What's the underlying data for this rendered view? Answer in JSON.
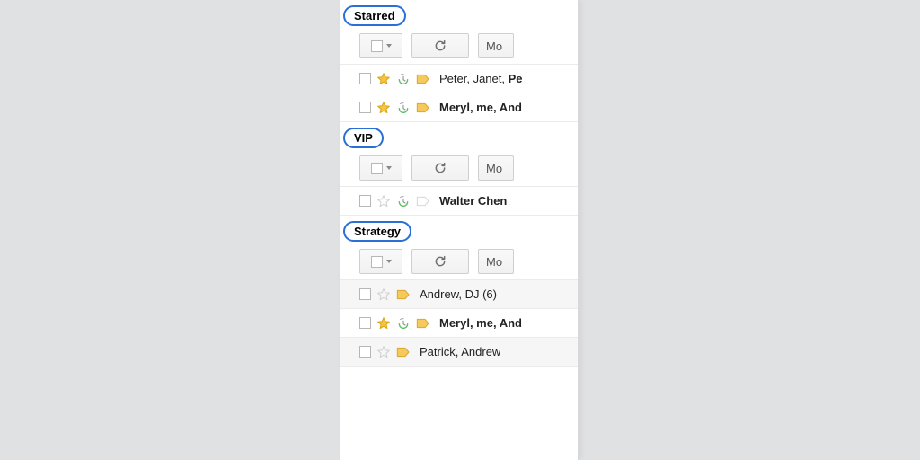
{
  "toolbar": {
    "more_label": "Mo"
  },
  "sections": [
    {
      "title": "Starred",
      "rows": [
        {
          "starred": true,
          "starOutline": false,
          "clock": true,
          "label": true,
          "labelFilled": true,
          "unread": false,
          "readbg": false,
          "sender_html": "Peter, Janet, <b>Pe</b>"
        },
        {
          "starred": true,
          "starOutline": false,
          "clock": true,
          "label": true,
          "labelFilled": true,
          "unread": true,
          "readbg": false,
          "sender_html": "Meryl, me, And"
        }
      ]
    },
    {
      "title": "VIP",
      "rows": [
        {
          "starred": false,
          "starOutline": true,
          "clock": true,
          "label": true,
          "labelFilled": false,
          "unread": true,
          "readbg": false,
          "sender_html": "Walter Chen"
        }
      ]
    },
    {
      "title": "Strategy",
      "rows": [
        {
          "starred": false,
          "starOutline": true,
          "clock": false,
          "label": true,
          "labelFilled": true,
          "unread": false,
          "readbg": true,
          "sender_html": "Andrew, DJ (6)"
        },
        {
          "starred": true,
          "starOutline": false,
          "clock": true,
          "label": true,
          "labelFilled": true,
          "unread": true,
          "readbg": false,
          "sender_html": "Meryl, me, And"
        },
        {
          "starred": false,
          "starOutline": true,
          "clock": false,
          "label": true,
          "labelFilled": true,
          "unread": false,
          "readbg": true,
          "sender_html": "Patrick, Andrew"
        }
      ]
    }
  ]
}
